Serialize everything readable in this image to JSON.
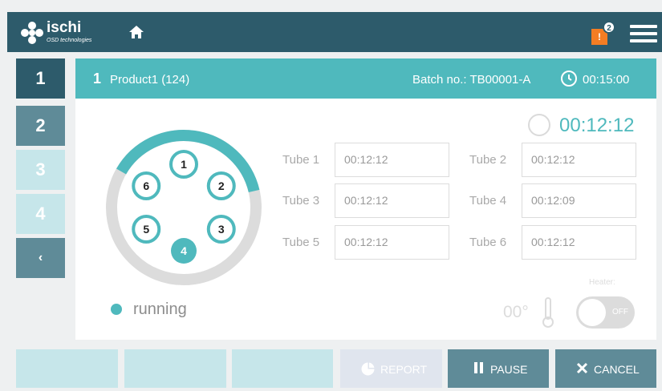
{
  "brand": {
    "name": "ischi",
    "tagline": "OSD technologies"
  },
  "header_icons": {
    "home": "home-icon",
    "alert": "alert-icon",
    "menu": "hamburger-menu-icon"
  },
  "alerts": {
    "symbol": "!",
    "count": "2"
  },
  "side_tabs": [
    {
      "label": "1",
      "state": "active"
    },
    {
      "label": "2",
      "state": "enabled"
    },
    {
      "label": "3",
      "state": "disabled"
    },
    {
      "label": "4",
      "state": "disabled"
    },
    {
      "label": "‹",
      "state": "back"
    }
  ],
  "station": {
    "number": "1",
    "product": "Product1 (124)",
    "batch": "Batch no.: TB00001-A",
    "total_time": "00:15:00",
    "countdown": "00:12:12"
  },
  "wheel": {
    "progress_fraction": 0.38,
    "positions": [
      {
        "label": "1",
        "active": false
      },
      {
        "label": "2",
        "active": false
      },
      {
        "label": "3",
        "active": false
      },
      {
        "label": "4",
        "active": true
      },
      {
        "label": "5",
        "active": false
      },
      {
        "label": "6",
        "active": false
      }
    ]
  },
  "tubes": [
    {
      "label": "Tube 1",
      "value": "00:12:12"
    },
    {
      "label": "Tube 2",
      "value": "00:12:12"
    },
    {
      "label": "Tube 3",
      "value": "00:12:12"
    },
    {
      "label": "Tube 4",
      "value": "00:12:09"
    },
    {
      "label": "Tube 5",
      "value": "00:12:12"
    },
    {
      "label": "Tube 6",
      "value": "00:12:12"
    }
  ],
  "status": "running",
  "heater": {
    "label": "Heater:",
    "temperature": "00°",
    "toggle": "OFF"
  },
  "actions": [
    {
      "label": ""
    },
    {
      "label": ""
    },
    {
      "label": ""
    },
    {
      "label": "REPORT",
      "icon": "pie-chart-icon"
    },
    {
      "label": "PAUSE",
      "icon": "pause-icon"
    },
    {
      "label": "CANCEL",
      "icon": "close-icon"
    }
  ],
  "colors": {
    "brand_dark": "#2d5b6b",
    "accent": "#4fb9bd",
    "muted": "#5f8b98",
    "disabled": "#c6e6ea",
    "alert": "#f37d23"
  }
}
